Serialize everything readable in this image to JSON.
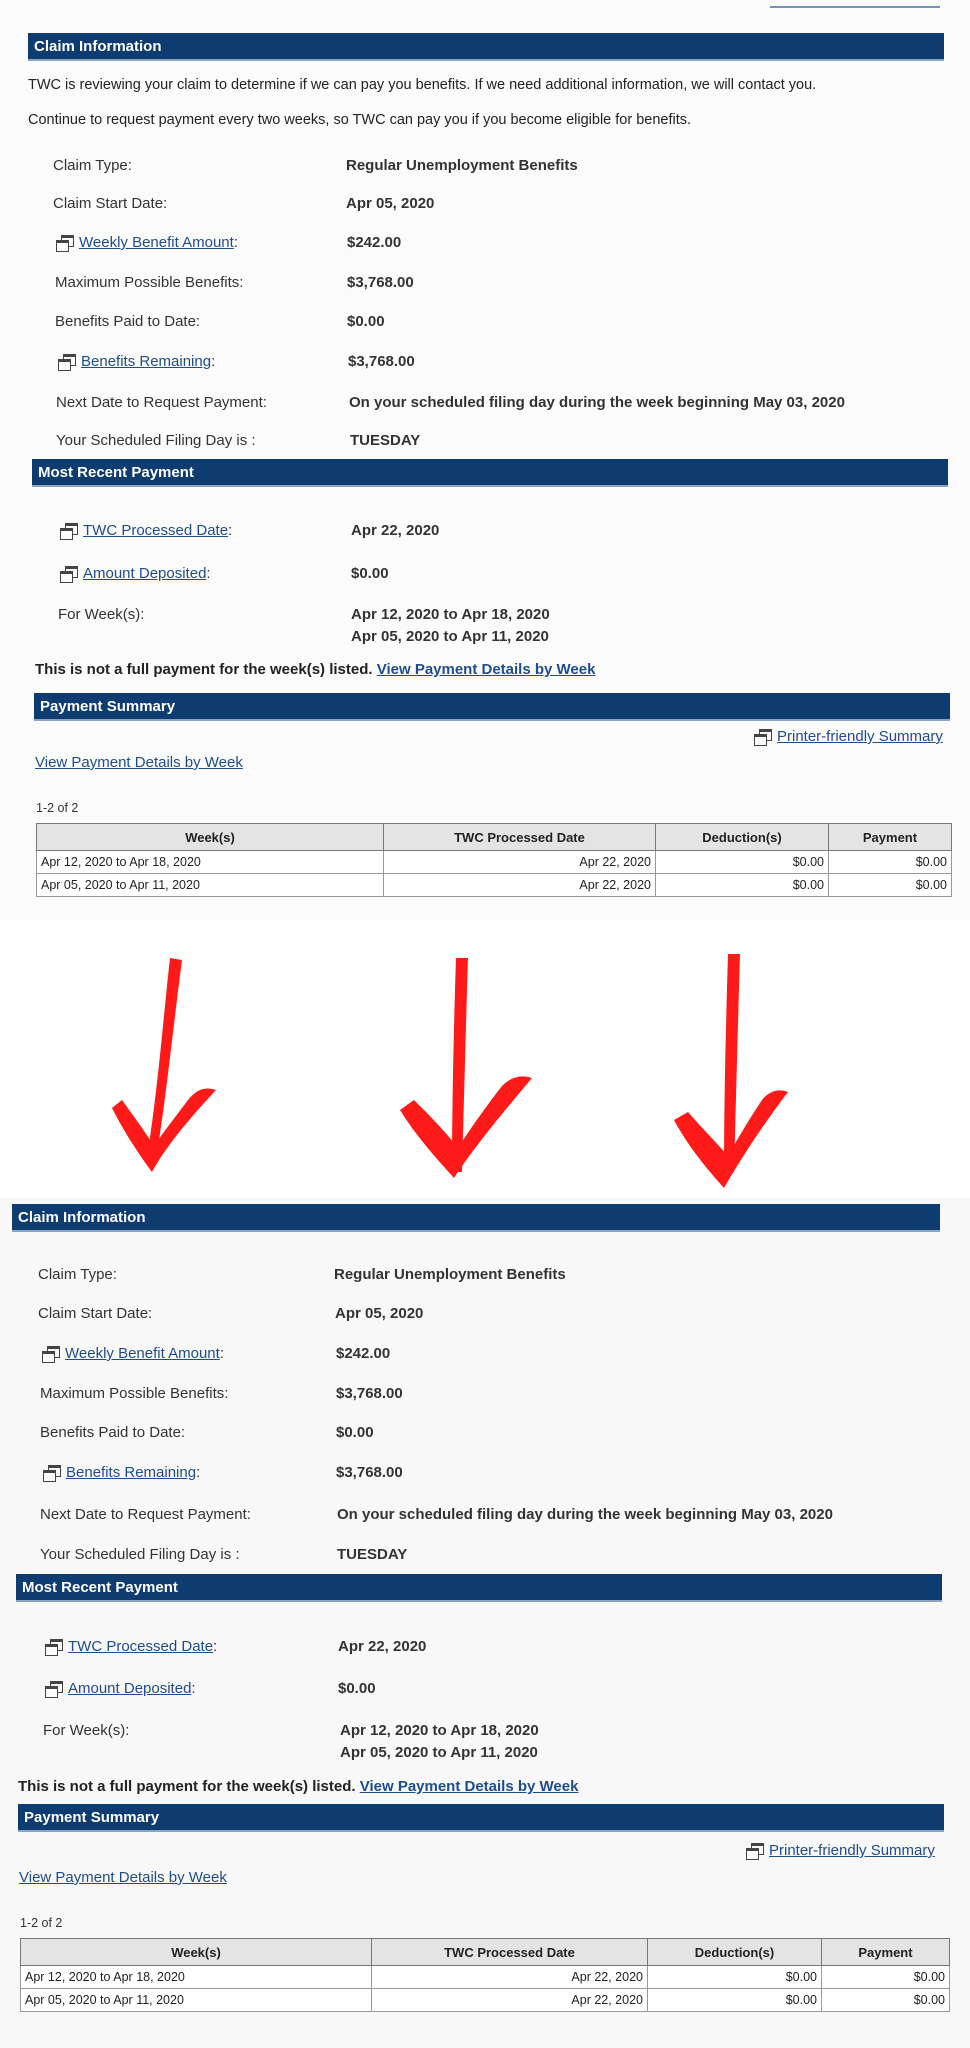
{
  "colors": {
    "header_bar": "#0e3c70",
    "link": "#1e4d8c",
    "arrow": "#ff0000"
  },
  "top": {
    "claim_header": "Claim Information",
    "intro_line1": "TWC is reviewing your claim to determine if we can pay you benefits. If we need additional information, we will contact you.",
    "intro_line2": "Continue to request payment every two weeks, so TWC can pay you if you become eligible for benefits.",
    "claim_rows": [
      {
        "label": "Claim Type:",
        "value": "Regular Unemployment Benefits"
      },
      {
        "label": "Claim Start Date:",
        "value": "Apr 05, 2020"
      },
      {
        "label": "Weekly Benefit Amount",
        "value": "$242.00"
      },
      {
        "label": "Maximum Possible Benefits:",
        "value": "$3,768.00"
      },
      {
        "label": "Benefits Paid to Date:",
        "value": "$0.00"
      },
      {
        "label": "Benefits Remaining",
        "value": "$3,768.00"
      },
      {
        "label": "Next Date to Request Payment:",
        "value": "On your scheduled filing day during the week beginning May 03, 2020"
      },
      {
        "label": "Your Scheduled Filing Day is :",
        "value": "TUESDAY"
      }
    ],
    "recent_header": "Most Recent Payment",
    "recent_rows": [
      {
        "label": "TWC Processed Date",
        "value": "Apr 22, 2020"
      },
      {
        "label": "Amount Deposited",
        "value": "$0.00"
      },
      {
        "label": "For Week(s):",
        "value": "Apr 12, 2020 to Apr 18, 2020",
        "value2": "Apr 05, 2020 to Apr 11, 2020"
      }
    ],
    "notice_text": "This is not a full payment for the week(s) listed.",
    "notice_link": "View Payment Details by Week",
    "summary_header": "Payment Summary",
    "printer_link": "Printer-friendly Summary",
    "details_link": "View Payment Details by Week",
    "count": "1-2 of 2",
    "table": {
      "headers": [
        "Week(s)",
        "TWC Processed Date",
        "Deduction(s)",
        "Payment"
      ],
      "rows": [
        [
          "Apr 12, 2020 to Apr 18, 2020",
          "Apr 22, 2020",
          "$0.00",
          "$0.00"
        ],
        [
          "Apr 05, 2020 to Apr 11, 2020",
          "Apr 22, 2020",
          "$0.00",
          "$0.00"
        ]
      ]
    }
  },
  "bottom": {
    "claim_header": "Claim Information",
    "claim_rows": [
      {
        "label": "Claim Type:",
        "value": "Regular Unemployment Benefits"
      },
      {
        "label": "Claim Start Date:",
        "value": "Apr 05, 2020"
      },
      {
        "label": "Weekly Benefit Amount",
        "value": "$242.00"
      },
      {
        "label": "Maximum Possible Benefits:",
        "value": "$3,768.00"
      },
      {
        "label": "Benefits Paid to Date:",
        "value": "$0.00"
      },
      {
        "label": "Benefits Remaining",
        "value": "$3,768.00"
      },
      {
        "label": "Next Date to Request Payment:",
        "value": "On your scheduled filing day during the week beginning May 03, 2020"
      },
      {
        "label": "Your Scheduled Filing Day is :",
        "value": "TUESDAY"
      }
    ],
    "recent_header": "Most Recent Payment",
    "recent_rows": [
      {
        "label": "TWC Processed Date",
        "value": "Apr 22, 2020"
      },
      {
        "label": "Amount Deposited",
        "value": "$0.00"
      },
      {
        "label": "For Week(s):",
        "value": "Apr 12, 2020 to Apr 18, 2020",
        "value2": "Apr 05, 2020 to Apr 11, 2020"
      }
    ],
    "notice_text": "This is not a full payment for the week(s) listed.",
    "notice_link": "View Payment Details by Week",
    "summary_header": "Payment Summary",
    "printer_link": "Printer-friendly Summary",
    "details_link": "View Payment Details by Week",
    "count": "1-2 of 2",
    "table": {
      "headers": [
        "Week(s)",
        "TWC Processed Date",
        "Deduction(s)",
        "Payment"
      ],
      "rows": [
        [
          "Apr 12, 2020 to Apr 18, 2020",
          "Apr 22, 2020",
          "$0.00",
          "$0.00"
        ],
        [
          "Apr 05, 2020 to Apr 11, 2020",
          "Apr 22, 2020",
          "$0.00",
          "$0.00"
        ]
      ]
    }
  }
}
